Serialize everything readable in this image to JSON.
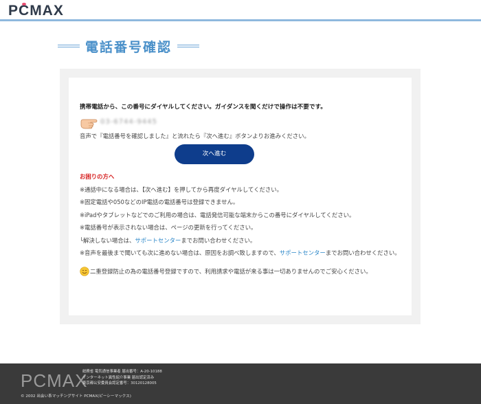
{
  "header": {
    "logo_text": "PCMAX"
  },
  "page": {
    "title": "電話番号確認"
  },
  "card": {
    "instruction": "携帯電話から、この番号にダイヤルしてください。ガイダンスを聞くだけで操作は不要です。",
    "phone_number": "03-6744-9445",
    "after_text": "音声で『電話番号を確認しました』と流れたら『次へ進む』ボタンよりお進みください。",
    "next_button_label": "次へ進む",
    "trouble_heading": "お困りの方へ",
    "notes": [
      "※通話中になる場合は、【次へ進む】を押してから再度ダイヤルしてください。",
      "※固定電話や050などのIP電話の電話番号は登録できません。",
      "※iPadやタブレットなどでのご利用の場合は、電話発信可能な端末からこの番号にダイヤルしてください。",
      "※電話番号が表示されない場合は、ページの更新を行ってください。"
    ],
    "support_note_1": {
      "prefix": "└解決しない場合は、",
      "link": "サポートセンター",
      "suffix": "までお問い合わせください。"
    },
    "support_note_2": {
      "prefix": "※音声を最後まで聞いても次に進めない場合は、原因をお調べ致しますので、",
      "link": "サポートセンター",
      "suffix": "までお問い合わせください。"
    },
    "reassurance": "二重登録防止の為の電話番号登録ですので、利用請求や電話が来る事は一切ありませんのでご安心ください。"
  },
  "footer": {
    "logo_text": "PCMAX",
    "info_lines": [
      "総務省 電気通信事業者 届出番号：A-20-10188",
      "インターネット異性紹介事業 届出認定済み",
      "東京都公安委員会認定番号：30120128005"
    ],
    "copyright": "© 2002 出会い系マッチングサイト PCMAX(ピーシーマックス)"
  },
  "colors": {
    "accent_blue": "#4a90c9",
    "button_navy": "#0e3d8c",
    "warning_red": "#d62020",
    "link_blue": "#2a86c8",
    "footer_bg": "#3a3a3a"
  },
  "icons": {
    "pointer": "pointing-hand-icon",
    "smile": "smile-icon"
  }
}
